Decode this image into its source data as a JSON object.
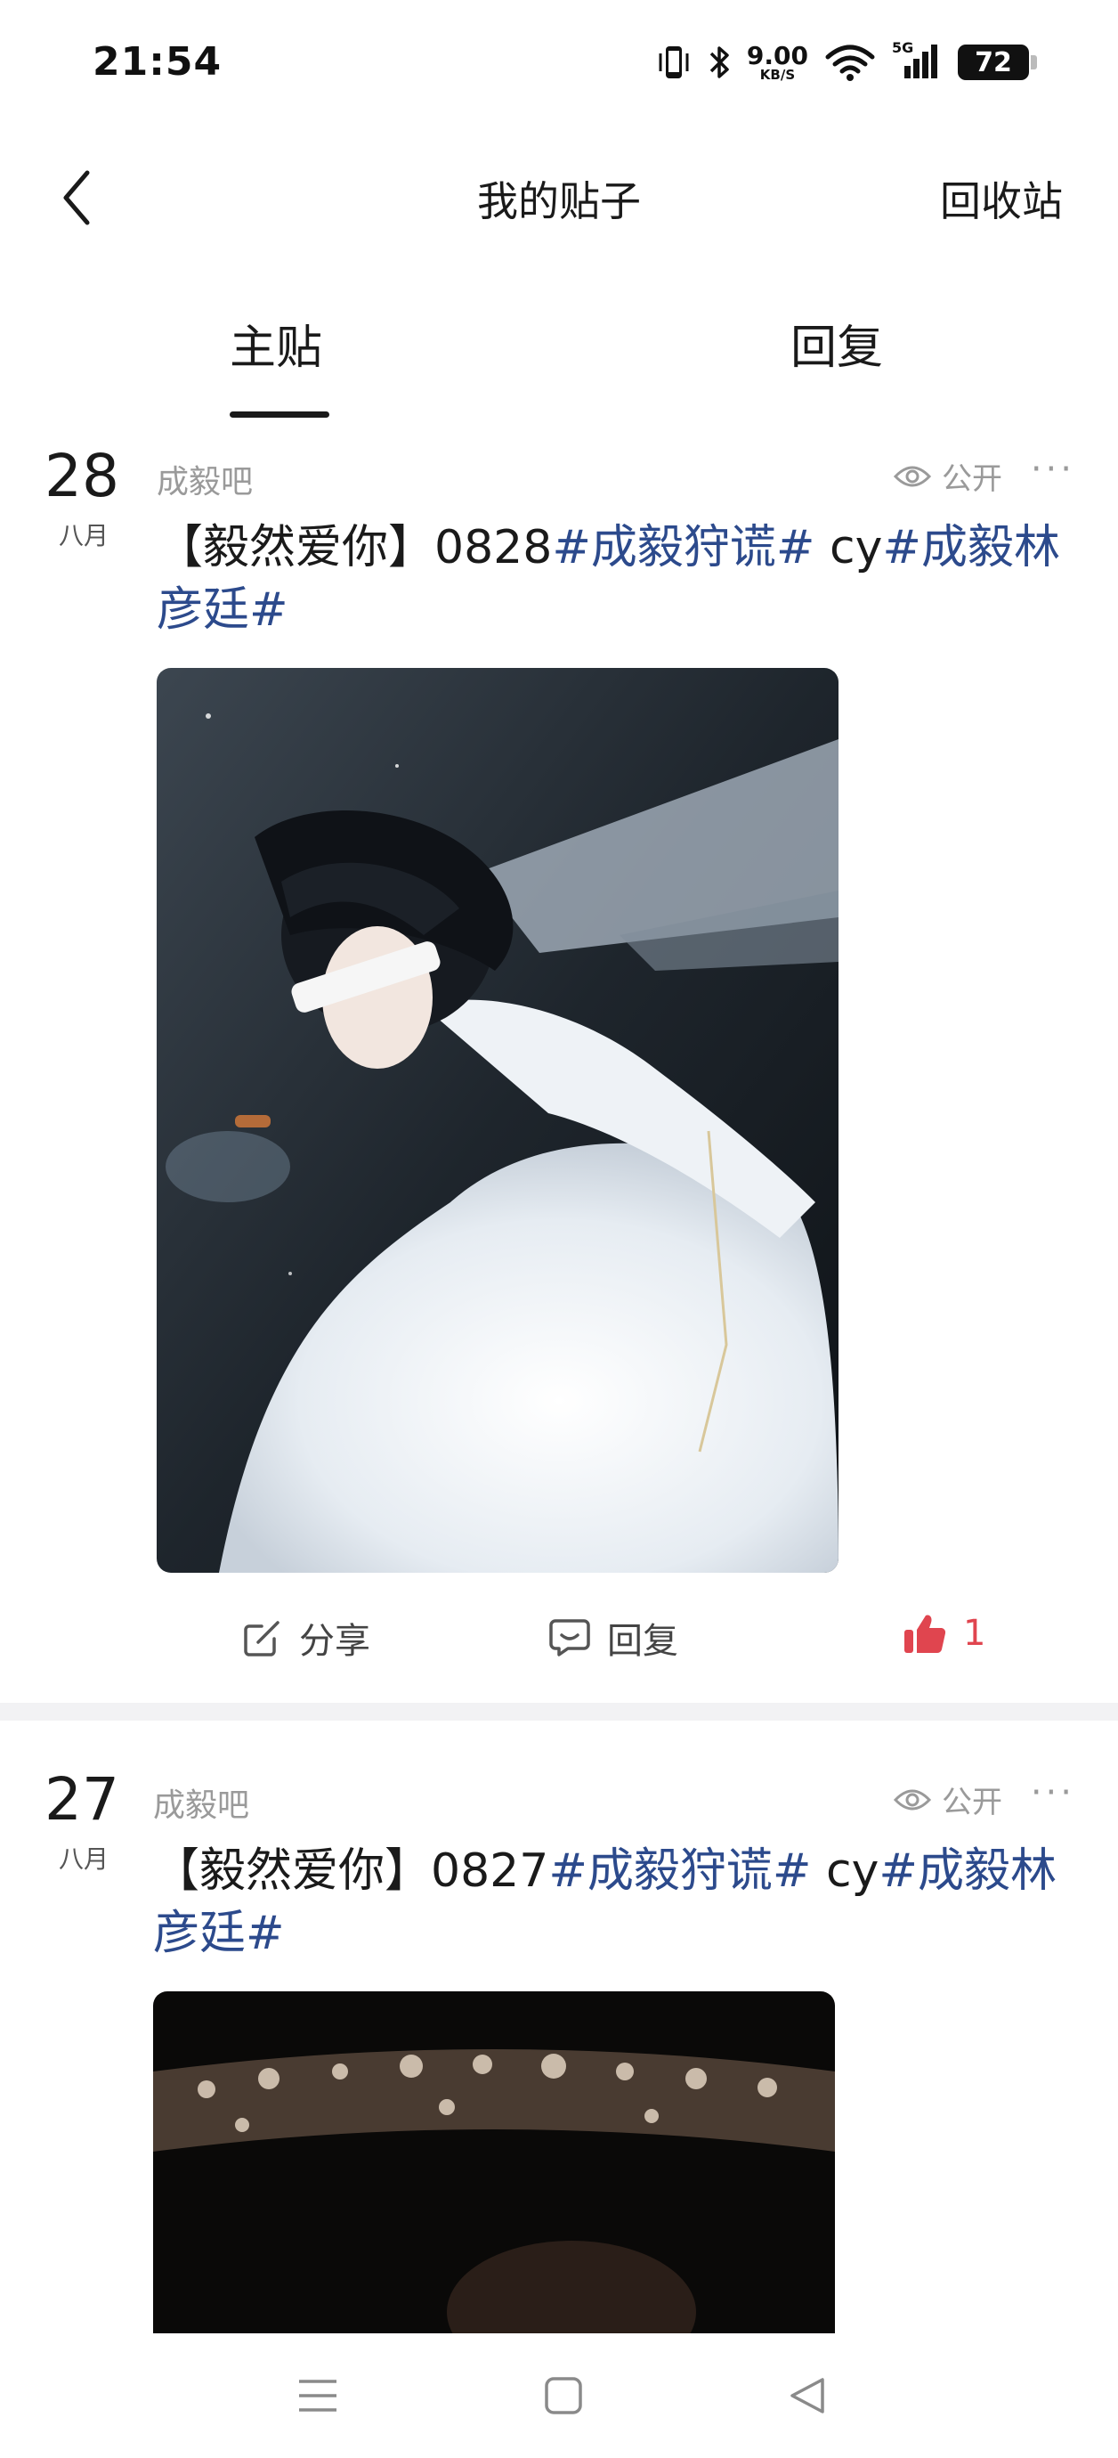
{
  "status_bar": {
    "time": "21:54",
    "net_speed_value": "9.00",
    "net_speed_unit": "KB/S",
    "network_type": "5G",
    "battery": "72",
    "icons": [
      "vibrate-icon",
      "bluetooth-icon",
      "wifi-icon",
      "signal-icon",
      "battery-icon"
    ]
  },
  "header": {
    "title": "我的贴子",
    "recycle_label": "回收站",
    "back_icon": "chevron-left-icon"
  },
  "tabs": [
    {
      "label": "主贴",
      "active": true
    },
    {
      "label": "回复",
      "active": false
    }
  ],
  "posts": [
    {
      "day": "28",
      "month": "八月",
      "forum": "成毅吧",
      "visibility": "公开",
      "more": "···",
      "title_prefix": "【毅然爱你】0828",
      "tag1": "#成毅狩谎#",
      "middle": " cy",
      "tag2": "#成毅林彦廷#",
      "share_label": "分享",
      "reply_label": "回复",
      "like_count": "1"
    },
    {
      "day": "27",
      "month": "八月",
      "forum": "成毅吧",
      "visibility": "公开",
      "more": "···",
      "title_prefix": "【毅然爱你】0827",
      "tag1": "#成毅狩谎#",
      "middle": " cy",
      "tag2": "#成毅林彦廷#"
    }
  ],
  "colors": {
    "tag_link": "#2c4a8c",
    "like": "#e0454f",
    "muted": "#9a9a9a",
    "divider": "#f2f2f4"
  }
}
